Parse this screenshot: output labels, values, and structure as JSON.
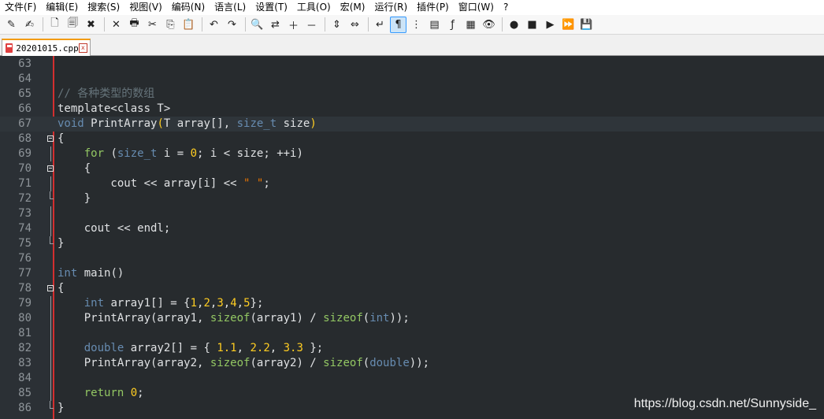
{
  "menu": [
    "文件(F)",
    "编辑(E)",
    "搜索(S)",
    "视图(V)",
    "编码(N)",
    "语言(L)",
    "设置(T)",
    "工具(O)",
    "宏(M)",
    "运行(R)",
    "插件(P)",
    "窗口(W)",
    "?"
  ],
  "toolbar": {
    "icons": [
      "new-file-icon",
      "open-file-icon",
      "save-icon",
      "save-all-icon",
      "close-icon",
      "close-all-icon",
      "print-icon",
      "cut-icon",
      "copy-icon",
      "paste-icon",
      "undo-icon",
      "redo-icon",
      "find-icon",
      "replace-icon",
      "zoom-in-icon",
      "zoom-out-icon",
      "sync-vertical-icon",
      "sync-horizontal-icon",
      "word-wrap-icon",
      "show-all-chars-icon",
      "indent-guide-icon",
      "doc-map-icon",
      "function-list-icon",
      "folder-workspace-icon",
      "monitor-icon",
      "record-macro-icon",
      "stop-macro-icon",
      "play-macro-icon",
      "run-macro-multiple-icon",
      "save-macro-icon"
    ],
    "glyphs": [
      "✎",
      "✍",
      "🗋",
      "🗐",
      "✖",
      "✕",
      "🖶",
      "✂",
      "⎘",
      "📋",
      "↶",
      "↷",
      "🔍",
      "⇄",
      "＋",
      "－",
      "⇕",
      "⇔",
      "↵",
      "¶",
      "⋮",
      "▤",
      "ƒ",
      "▦",
      "👁",
      "●",
      "■",
      "▶",
      "⏩",
      "💾"
    ],
    "active_index": 19
  },
  "tab": {
    "label": "20201015.cpp",
    "close": "x"
  },
  "editor": {
    "lines": [
      {
        "n": "63",
        "html": ""
      },
      {
        "n": "64",
        "html": ""
      },
      {
        "n": "65",
        "html": "<span class=\"c-comment\">// 各种类型的数组</span>"
      },
      {
        "n": "66",
        "html": "template&lt;class T&gt;"
      },
      {
        "n": "67",
        "html": "<span class=\"c-kw\">void</span> PrintArray<span class=\"c-paren\">(</span>T array[], <span class=\"c-kw\">size_t</span> size<span class=\"c-paren\">)</span>"
      },
      {
        "n": "68",
        "html": "{"
      },
      {
        "n": "69",
        "html": "    <span class=\"c-kw2\">for</span> (<span class=\"c-kw\">size_t</span> i = <span class=\"c-num\">0</span>; i &lt; size; ++i)"
      },
      {
        "n": "70",
        "html": "    {"
      },
      {
        "n": "71",
        "html": "        cout &lt;&lt; array[i] &lt;&lt; <span class=\"c-str\">\" \"</span>;"
      },
      {
        "n": "72",
        "html": "    }"
      },
      {
        "n": "73",
        "html": ""
      },
      {
        "n": "74",
        "html": "    cout &lt;&lt; endl;"
      },
      {
        "n": "75",
        "html": "}"
      },
      {
        "n": "76",
        "html": ""
      },
      {
        "n": "77",
        "html": "<span class=\"c-kw\">int</span> main()"
      },
      {
        "n": "78",
        "html": "{"
      },
      {
        "n": "79",
        "html": "    <span class=\"c-kw\">int</span> array1[] = {<span class=\"c-num\">1</span>,<span class=\"c-num\">2</span>,<span class=\"c-num\">3</span>,<span class=\"c-num\">4</span>,<span class=\"c-num\">5</span>};"
      },
      {
        "n": "80",
        "html": "    PrintArray(array1, <span class=\"c-kw2\">sizeof</span>(array1) / <span class=\"c-kw2\">sizeof</span>(<span class=\"c-kw\">int</span>));"
      },
      {
        "n": "81",
        "html": ""
      },
      {
        "n": "82",
        "html": "    <span class=\"c-kw\">double</span> array2[] = { <span class=\"c-num\">1.1</span>, <span class=\"c-num\">2.2</span>, <span class=\"c-num\">3.3</span> };"
      },
      {
        "n": "83",
        "html": "    PrintArray(array2, <span class=\"c-kw2\">sizeof</span>(array2) / <span class=\"c-kw2\">sizeof</span>(<span class=\"c-kw\">double</span>));"
      },
      {
        "n": "84",
        "html": ""
      },
      {
        "n": "85",
        "html": "    <span class=\"c-kw2\">return</span> <span class=\"c-num\">0</span>;"
      },
      {
        "n": "86",
        "html": "}"
      }
    ],
    "fold_open_lines": [
      "68",
      "70",
      "78"
    ],
    "fold_end_lines": [
      "72",
      "75",
      "86"
    ],
    "fold_inner_lines": [
      "69",
      "71",
      "73",
      "74",
      "79",
      "80",
      "81",
      "82",
      "83",
      "84",
      "85"
    ],
    "highlight_line": "67"
  },
  "watermark": "https://blog.csdn.net/Sunnyside_",
  "colors": {
    "editor_bg": "#272b2e",
    "comment": "#66747b",
    "keyword": "#678cb1",
    "keyword2": "#93c763",
    "number": "#ffcd22",
    "string": "#ec7600"
  }
}
